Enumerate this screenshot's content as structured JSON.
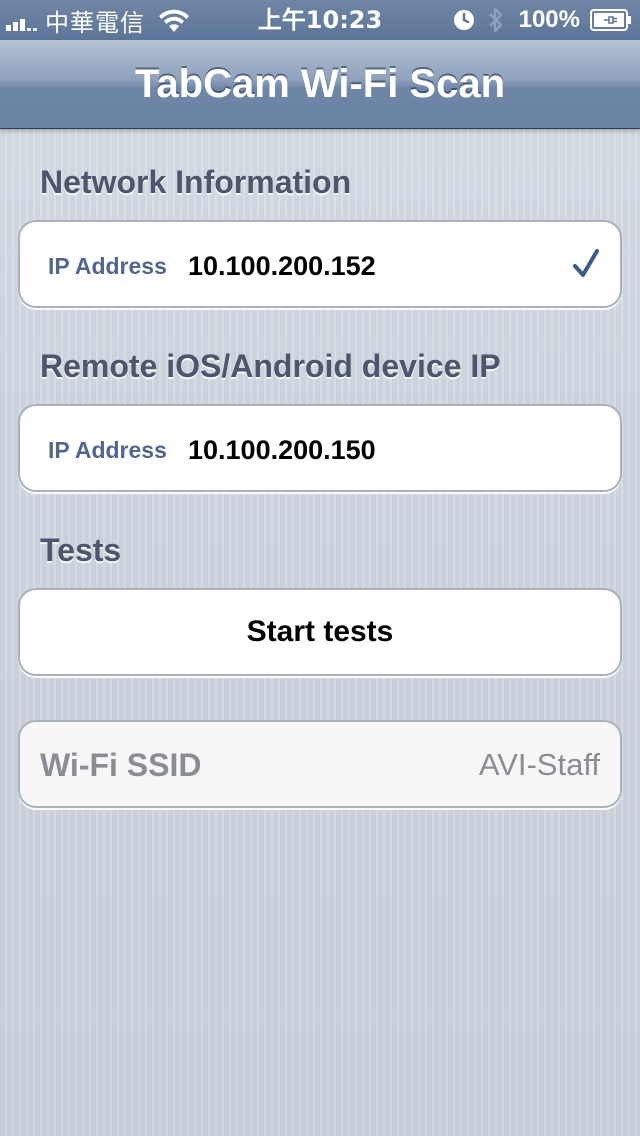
{
  "status_bar": {
    "carrier": "中華電信",
    "time": "上午10:23",
    "battery": "100%"
  },
  "nav": {
    "title": "TabCam Wi-Fi Scan"
  },
  "sections": {
    "network": {
      "header": "Network Information",
      "label": "IP Address",
      "value": "10.100.200.152"
    },
    "remote": {
      "header": "Remote iOS/Android device IP",
      "label": "IP Address",
      "value": "10.100.200.150"
    },
    "tests": {
      "header": "Tests",
      "button_label": "Start tests"
    },
    "wifi": {
      "label": "Wi-Fi SSID",
      "value": "AVI-Staff"
    }
  },
  "colors": {
    "nav_bar": "#6a82a3",
    "section_header": "#4c566c",
    "cell_label": "#52668f",
    "checkmark": "#3b5a8f"
  },
  "icons": [
    "signal-strength-icon",
    "wifi-icon",
    "alarm-clock-icon",
    "bluetooth-icon",
    "battery-icon",
    "checkmark-icon"
  ]
}
